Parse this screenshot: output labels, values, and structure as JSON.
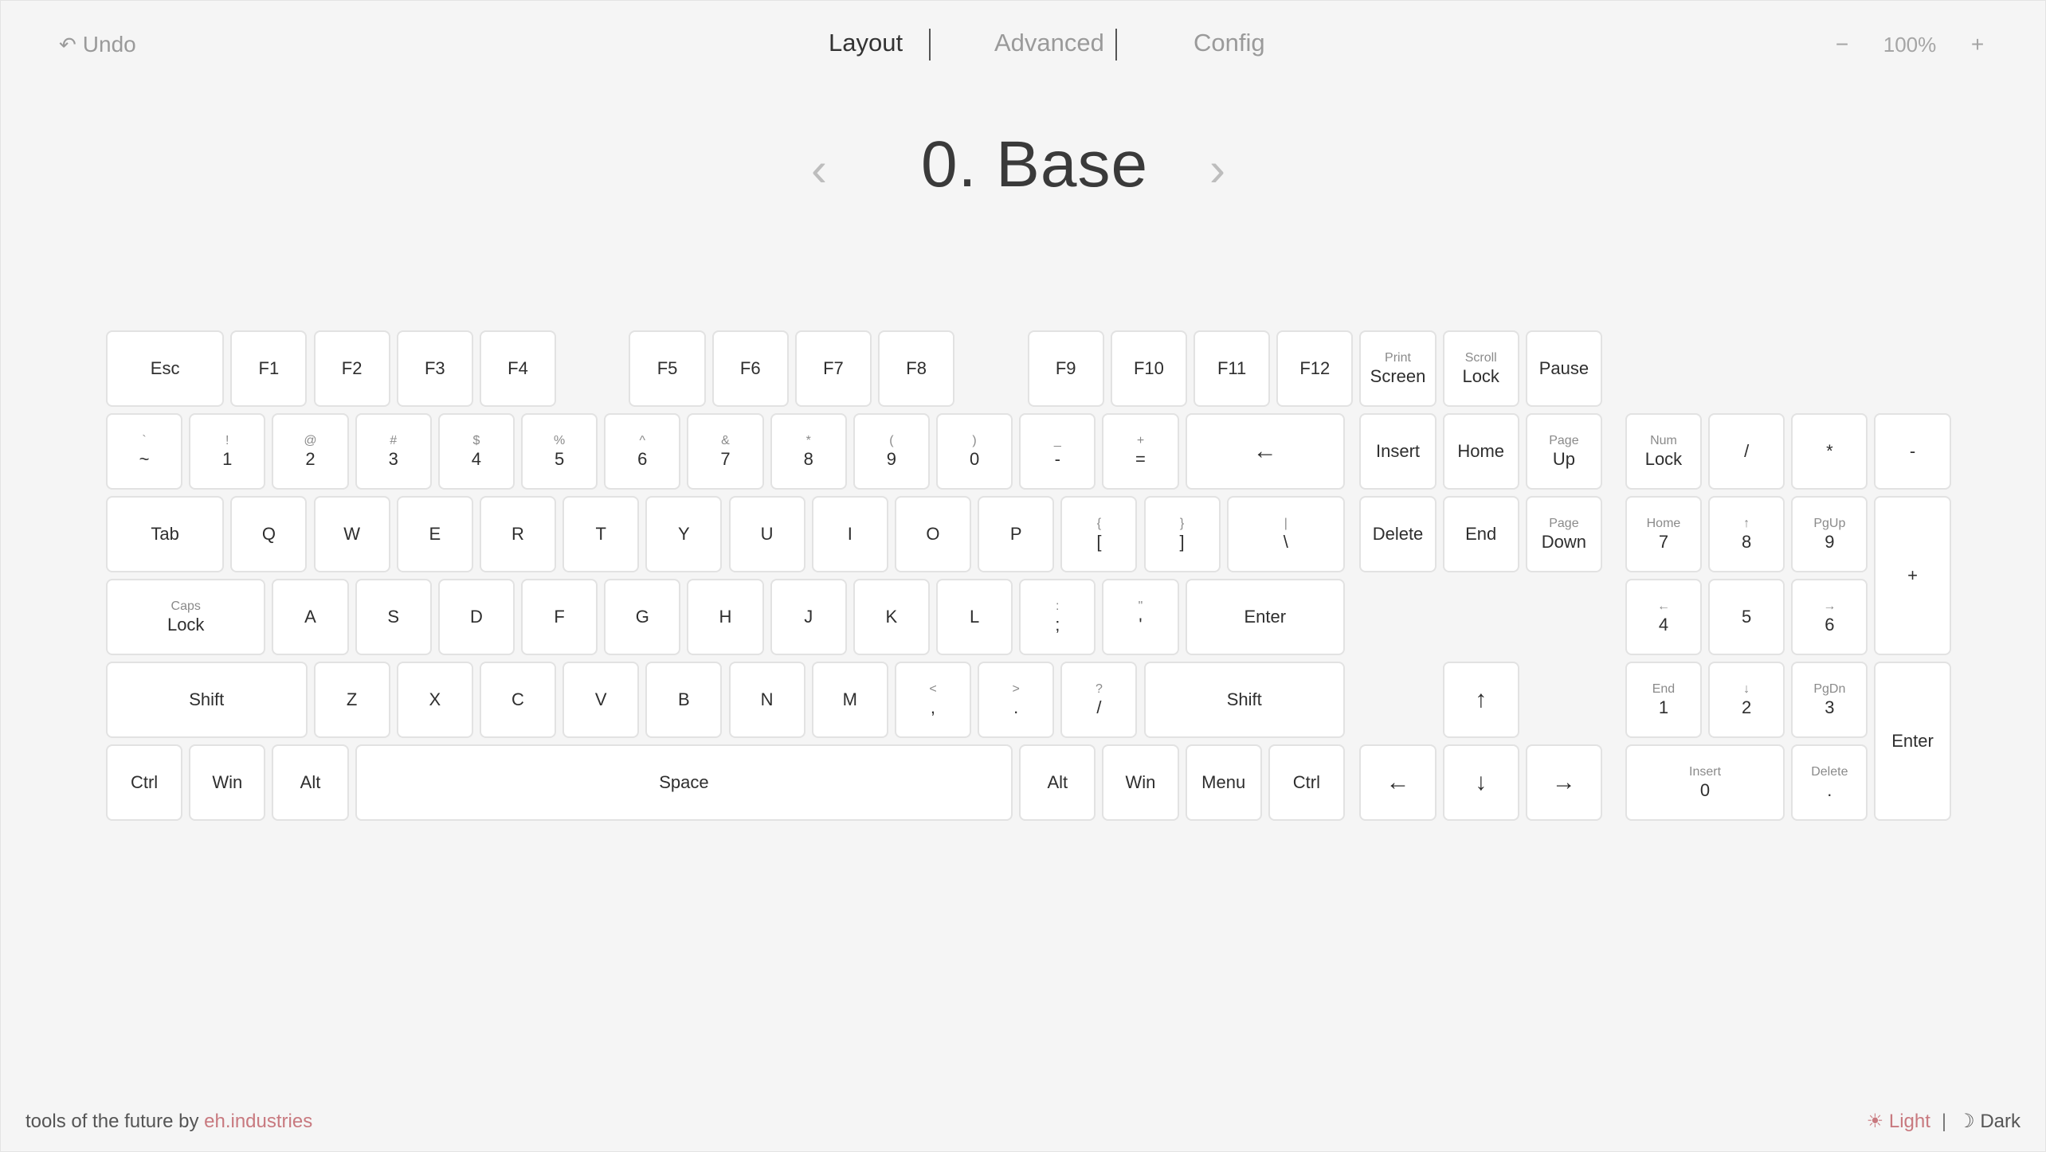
{
  "toolbar": {
    "undo_label": "Undo",
    "undo_icon": "↶"
  },
  "tabs": [
    {
      "label": "Layout",
      "active": true
    },
    {
      "label": "Advanced",
      "active": false
    },
    {
      "label": "Config",
      "active": false
    }
  ],
  "zoom": {
    "minus": "−",
    "value": "100%",
    "plus": "+"
  },
  "layer": {
    "prev": "‹",
    "title": "0. Base",
    "next": "›"
  },
  "keys": [
    {
      "main": "Esc"
    },
    {
      "main": "F1"
    },
    {
      "main": "F2"
    },
    {
      "main": "F3"
    },
    {
      "main": "F4"
    },
    {
      "main": "F5"
    },
    {
      "main": "F6"
    },
    {
      "main": "F7"
    },
    {
      "main": "F8"
    },
    {
      "main": "F9"
    },
    {
      "main": "F10"
    },
    {
      "main": "F11"
    },
    {
      "main": "F12"
    },
    {
      "sub": "Print",
      "main": "Screen"
    },
    {
      "sub": "Scroll",
      "main": "Lock"
    },
    {
      "main": "Pause"
    },
    {
      "sub": "`",
      "main": "~"
    },
    {
      "sub": "!",
      "main": "1"
    },
    {
      "sub": "@",
      "main": "2"
    },
    {
      "sub": "#",
      "main": "3"
    },
    {
      "sub": "$",
      "main": "4"
    },
    {
      "sub": "%",
      "main": "5"
    },
    {
      "sub": "^",
      "main": "6"
    },
    {
      "sub": "&",
      "main": "7"
    },
    {
      "sub": "*",
      "main": "8"
    },
    {
      "sub": "(",
      "main": "9"
    },
    {
      "sub": ")",
      "main": "0"
    },
    {
      "sub": "_",
      "main": "-"
    },
    {
      "sub": "+",
      "main": "="
    },
    {
      "main": "←"
    },
    {
      "main": "Insert"
    },
    {
      "main": "Home"
    },
    {
      "sub": "Page",
      "main": "Up"
    },
    {
      "sub": "Num",
      "main": "Lock"
    },
    {
      "main": "/"
    },
    {
      "main": "*"
    },
    {
      "main": "-"
    },
    {
      "main": "Tab"
    },
    {
      "main": "Q"
    },
    {
      "main": "W"
    },
    {
      "main": "E"
    },
    {
      "main": "R"
    },
    {
      "main": "T"
    },
    {
      "main": "Y"
    },
    {
      "main": "U"
    },
    {
      "main": "I"
    },
    {
      "main": "O"
    },
    {
      "main": "P"
    },
    {
      "sub": "{",
      "main": "["
    },
    {
      "sub": "}",
      "main": "]"
    },
    {
      "sub": "|",
      "main": "\\"
    },
    {
      "main": "Delete"
    },
    {
      "main": "End"
    },
    {
      "sub": "Page",
      "main": "Down"
    },
    {
      "sub": "Home",
      "main": "7"
    },
    {
      "sub": "↑",
      "main": "8"
    },
    {
      "sub": "PgUp",
      "main": "9"
    },
    {
      "main": "+"
    },
    {
      "sub": "Caps",
      "main": "Lock"
    },
    {
      "main": "A"
    },
    {
      "main": "S"
    },
    {
      "main": "D"
    },
    {
      "main": "F"
    },
    {
      "main": "G"
    },
    {
      "main": "H"
    },
    {
      "main": "J"
    },
    {
      "main": "K"
    },
    {
      "main": "L"
    },
    {
      "sub": ":",
      "main": ";"
    },
    {
      "sub": "\"",
      "main": "'"
    },
    {
      "main": "Enter"
    },
    {
      "sub": "←",
      "main": "4"
    },
    {
      "main": "5"
    },
    {
      "sub": "→",
      "main": "6"
    },
    {
      "main": "Shift"
    },
    {
      "main": "Z"
    },
    {
      "main": "X"
    },
    {
      "main": "C"
    },
    {
      "main": "V"
    },
    {
      "main": "B"
    },
    {
      "main": "N"
    },
    {
      "main": "M"
    },
    {
      "sub": "<",
      "main": ","
    },
    {
      "sub": ">",
      "main": "."
    },
    {
      "sub": "?",
      "main": "/"
    },
    {
      "main": "Shift"
    },
    {
      "main": "↑"
    },
    {
      "sub": "End",
      "main": "1"
    },
    {
      "sub": "↓",
      "main": "2"
    },
    {
      "sub": "PgDn",
      "main": "3"
    },
    {
      "main": "Enter"
    },
    {
      "main": "Ctrl"
    },
    {
      "main": "Win"
    },
    {
      "main": "Alt"
    },
    {
      "main": "Space"
    },
    {
      "main": "Alt"
    },
    {
      "main": "Win"
    },
    {
      "main": "Menu"
    },
    {
      "main": "Ctrl"
    },
    {
      "main": "←"
    },
    {
      "main": "↓"
    },
    {
      "main": "→"
    },
    {
      "sub": "Insert",
      "main": "0"
    },
    {
      "sub": "Delete",
      "main": "."
    }
  ],
  "footer": {
    "tagline": "tools of the future by",
    "brand": "eh.industries",
    "light_icon": "☀",
    "light_label": "Light",
    "separator": "|",
    "dark_icon": "☽",
    "dark_label": "Dark"
  },
  "colors": {
    "accent": "#c8797f",
    "background": "#f5f5f5",
    "key": "#ffffff",
    "key_border": "#e2e2e2"
  }
}
